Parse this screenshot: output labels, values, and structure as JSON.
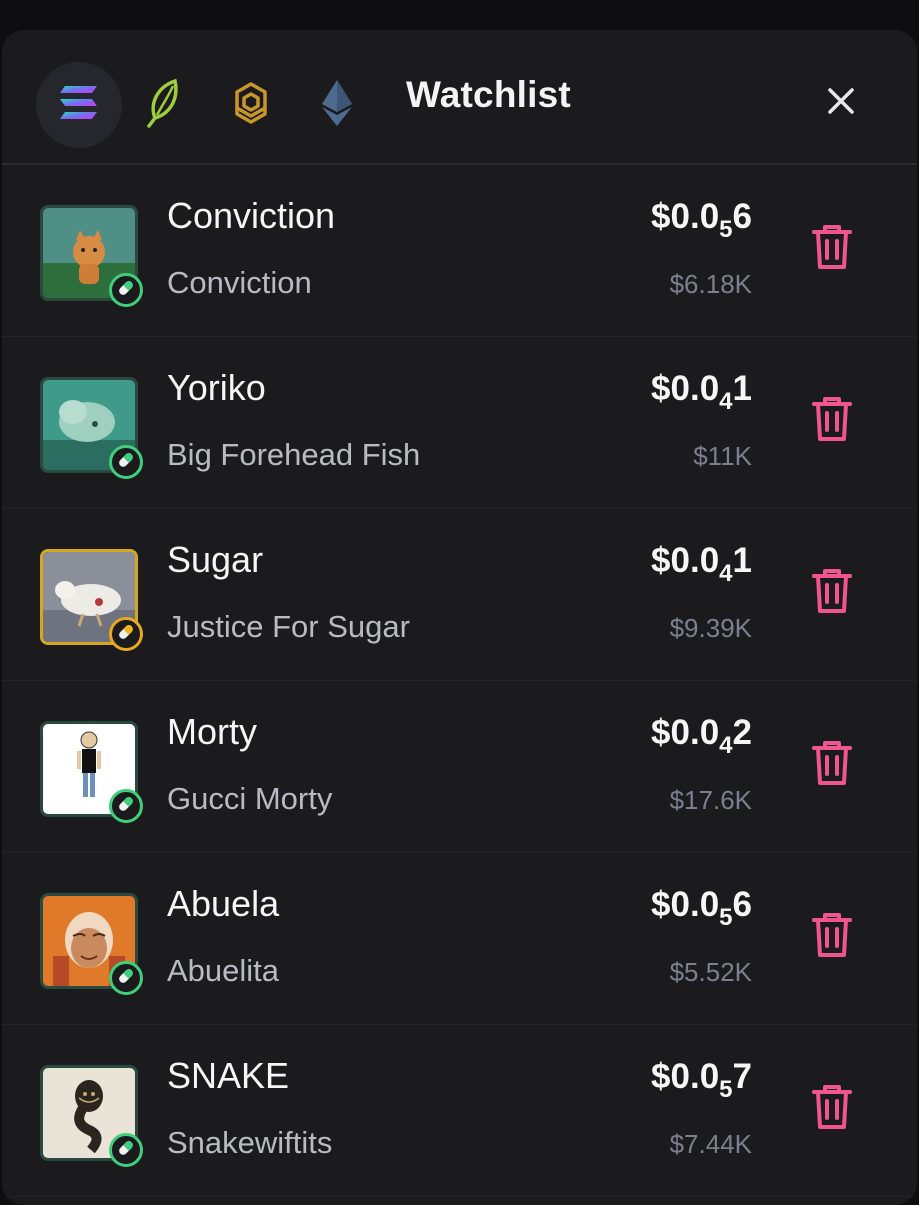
{
  "header": {
    "title": "Watchlist",
    "chains": [
      {
        "name": "solana",
        "active": true
      },
      {
        "name": "leaf",
        "active": false
      },
      {
        "name": "bnb",
        "active": false
      },
      {
        "name": "ethereum",
        "active": false
      }
    ]
  },
  "colors": {
    "accent_green": "#3ecf7c",
    "accent_gold": "#e7a81f",
    "trash_pink": "#f0558f"
  },
  "items": [
    {
      "name": "Conviction",
      "subname": "Conviction",
      "price_prefix": "$0.0",
      "price_zeros": "5",
      "price_digits": "6",
      "mcap": "$6.18K",
      "badge": "green",
      "thumb": "orange-cat-in-grass"
    },
    {
      "name": "Yoriko",
      "subname": "Big Forehead Fish",
      "price_prefix": "$0.0",
      "price_zeros": "4",
      "price_digits": "1",
      "mcap": "$11K",
      "badge": "green",
      "thumb": "big-forehead-fish"
    },
    {
      "name": "Sugar",
      "subname": "Justice For Sugar",
      "price_prefix": "$0.0",
      "price_zeros": "4",
      "price_digits": "1",
      "mcap": "$9.39K",
      "badge": "gold",
      "thumb": "white-bird"
    },
    {
      "name": "Morty",
      "subname": "Gucci Morty",
      "price_prefix": "$0.0",
      "price_zeros": "4",
      "price_digits": "2",
      "mcap": "$17.6K",
      "badge": "green",
      "thumb": "standing-figure"
    },
    {
      "name": "Abuela",
      "subname": "Abuelita",
      "price_prefix": "$0.0",
      "price_zeros": "5",
      "price_digits": "6",
      "mcap": "$5.52K",
      "badge": "green",
      "thumb": "grandma-portrait"
    },
    {
      "name": "SNAKE",
      "subname": "Snakewiftits",
      "price_prefix": "$0.0",
      "price_zeros": "5",
      "price_digits": "7",
      "mcap": "$7.44K",
      "badge": "green",
      "thumb": "cobra-figurine"
    }
  ]
}
